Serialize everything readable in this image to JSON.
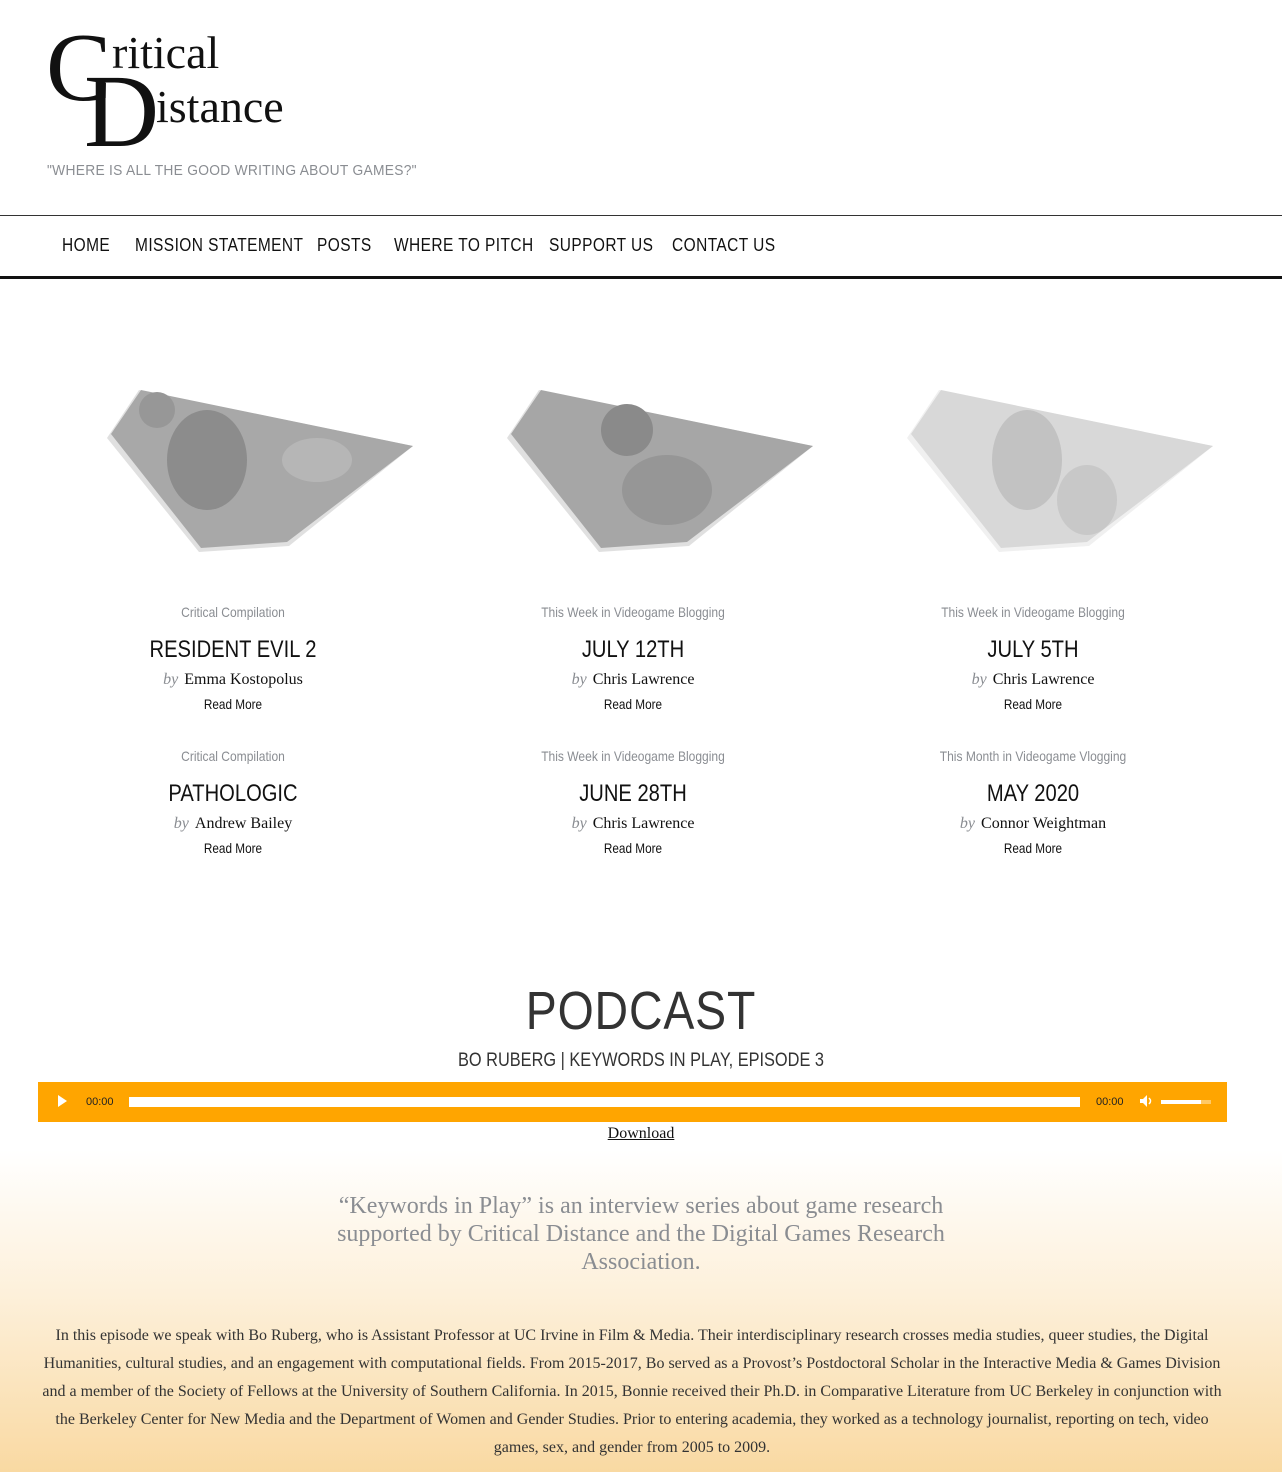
{
  "header": {
    "logo_text": "Critical Distance",
    "tagline": "\"WHERE IS ALL THE GOOD WRITING ABOUT GAMES?\""
  },
  "nav": {
    "items": [
      {
        "label": "HOME"
      },
      {
        "label": "MISSION STATEMENT"
      },
      {
        "label": "POSTS"
      },
      {
        "label": "WHERE TO PITCH"
      },
      {
        "label": "SUPPORT US"
      },
      {
        "label": "CONTACT US"
      }
    ]
  },
  "posts": [
    {
      "category": "Critical Compilation",
      "title": "RESIDENT EVIL 2",
      "by": "by",
      "author": "Emma Kostopolus",
      "more": "Read More"
    },
    {
      "category": "This Week in Videogame Blogging",
      "title": "JULY 12TH",
      "by": "by",
      "author": "Chris Lawrence",
      "more": "Read More"
    },
    {
      "category": "This Week in Videogame Blogging",
      "title": "JULY 5TH",
      "by": "by",
      "author": "Chris Lawrence",
      "more": "Read More"
    },
    {
      "category": "Critical Compilation",
      "title": "PATHOLOGIC",
      "by": "by",
      "author": "Andrew Bailey",
      "more": "Read More"
    },
    {
      "category": "This Week in Videogame Blogging",
      "title": "JUNE 28TH",
      "by": "by",
      "author": "Chris Lawrence",
      "more": "Read More"
    },
    {
      "category": "This Month in Videogame Vlogging",
      "title": "MAY 2020",
      "by": "by",
      "author": "Connor Weightman",
      "more": "Read More"
    }
  ],
  "podcast": {
    "heading": "PODCAST",
    "episode_title": "BO RUBERG | KEYWORDS IN PLAY, EPISODE 3",
    "player": {
      "current_time": "00:00",
      "duration": "00:00",
      "progress": 0,
      "volume": 0.8,
      "accent": "#ffa500"
    },
    "download_label": "Download",
    "intro": "“Keywords in Play” is an interview series about game research supported by Critical Distance and the Digital Games Research Association.",
    "body": "In this episode we speak with Bo Ruberg, who is Assistant Professor at UC Irvine in Film & Media. Their interdisciplinary research crosses media studies, queer studies, the Digital Humanities, cultural studies, and an engagement with computational fields. From 2015-2017, Bo served as a Provost’s Postdoctoral Scholar in the Interactive Media & Games Division and a member of the Society of Fellows at the University of Southern California. In 2015, Bonnie received their Ph.D. in Comparative Literature from UC Berkeley in conjunction with the Berkeley Center for New Media and the Department of Women and Gender Studies. Prior to entering academia, they worked as a technology journalist, reporting on tech, video games, sex, and gender from 2005 to 2009."
  }
}
